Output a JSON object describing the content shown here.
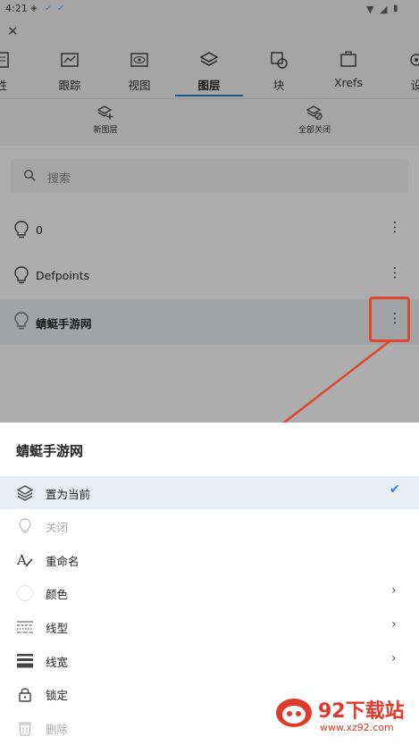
{
  "status": {
    "time": "4:21"
  },
  "appbar": {
    "close_icon": "close-icon"
  },
  "tabs": [
    {
      "label": "性",
      "icon": "properties-icon",
      "active": false
    },
    {
      "label": "跟踪",
      "icon": "track-icon",
      "active": false
    },
    {
      "label": "视图",
      "icon": "view-icon",
      "active": false
    },
    {
      "label": "图层",
      "icon": "layers-icon",
      "active": true
    },
    {
      "label": "块",
      "icon": "block-icon",
      "active": false
    },
    {
      "label": "Xrefs",
      "icon": "xrefs-icon",
      "active": false
    },
    {
      "label": "设",
      "icon": "settings-icon",
      "active": false
    }
  ],
  "toolbar": {
    "new_layer": "新图层",
    "close_all": "全部关闭"
  },
  "search": {
    "placeholder": "搜索"
  },
  "layers": [
    {
      "name": "0"
    },
    {
      "name": "Defpoints"
    },
    {
      "name": "蜻蜓手游网"
    }
  ],
  "sheet": {
    "title": "蜻蜓手游网",
    "items": [
      {
        "label": "置为当前",
        "icon": "layers-icon",
        "selected": true,
        "disabled": false
      },
      {
        "label": "关闭",
        "icon": "bulb-icon",
        "disabled": true
      },
      {
        "label": "重命名",
        "icon": "rename-icon",
        "disabled": false
      },
      {
        "label": "颜色",
        "icon": "color-swatch-icon",
        "disabled": false,
        "chevron": true
      },
      {
        "label": "线型",
        "icon": "linetype-icon",
        "disabled": false,
        "chevron": true
      },
      {
        "label": "线宽",
        "icon": "lineweight-icon",
        "disabled": false,
        "chevron": true
      },
      {
        "label": "锁定",
        "icon": "lock-icon",
        "disabled": false
      },
      {
        "label": "删除",
        "icon": "trash-icon",
        "disabled": true
      }
    ]
  },
  "watermark": {
    "brand": "92下载站",
    "url": "www.xz92.com"
  },
  "colors": {
    "accent": "#2a7fd6",
    "annotation": "#e0462b"
  }
}
